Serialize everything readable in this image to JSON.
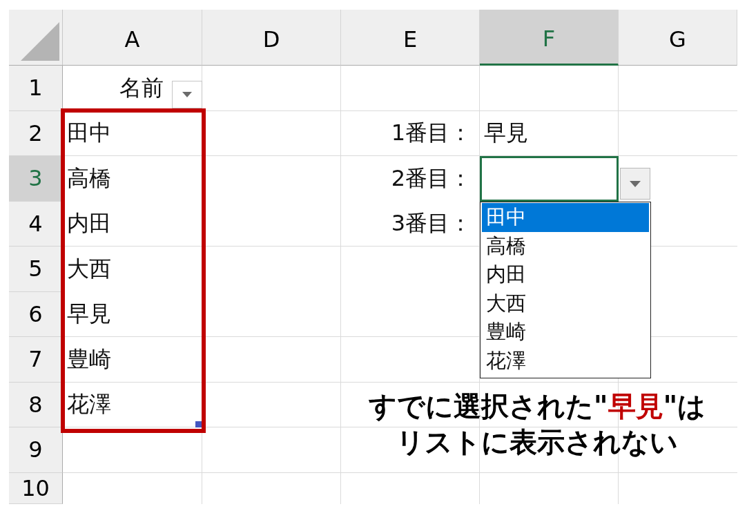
{
  "columns": [
    {
      "label": "A",
      "selected": false
    },
    {
      "label": "D",
      "selected": false
    },
    {
      "label": "E",
      "selected": false
    },
    {
      "label": "F",
      "selected": true
    },
    {
      "label": "G",
      "selected": false
    }
  ],
  "rows": [
    {
      "number": "1",
      "selected": false,
      "col_a": "名前",
      "filter_button": true
    },
    {
      "number": "2",
      "selected": false,
      "col_a": "田中",
      "col_e": "1番目：",
      "col_f": "早見"
    },
    {
      "number": "3",
      "selected": true,
      "col_a": "高橋",
      "col_e": "2番目：",
      "col_f_active": true
    },
    {
      "number": "4",
      "selected": false,
      "col_a": "内田",
      "col_e": "3番目："
    },
    {
      "number": "5",
      "selected": false,
      "col_a": "大西"
    },
    {
      "number": "6",
      "selected": false,
      "col_a": "早見"
    },
    {
      "number": "7",
      "selected": false,
      "col_a": "豊崎"
    },
    {
      "number": "8",
      "selected": false,
      "col_a": "花澤"
    },
    {
      "number": "9",
      "selected": false
    },
    {
      "number": "10",
      "selected": false
    }
  ],
  "dropdown": {
    "open": true,
    "items": [
      {
        "label": "田中",
        "selected": true
      },
      {
        "label": "高橋",
        "selected": false
      },
      {
        "label": "内田",
        "selected": false
      },
      {
        "label": "大西",
        "selected": false
      },
      {
        "label": "豊崎",
        "selected": false
      },
      {
        "label": "花澤",
        "selected": false
      }
    ]
  },
  "annotation": {
    "lines": [
      "すでに選択された\"**早見**\"は",
      "リストに表示されない"
    ]
  }
}
